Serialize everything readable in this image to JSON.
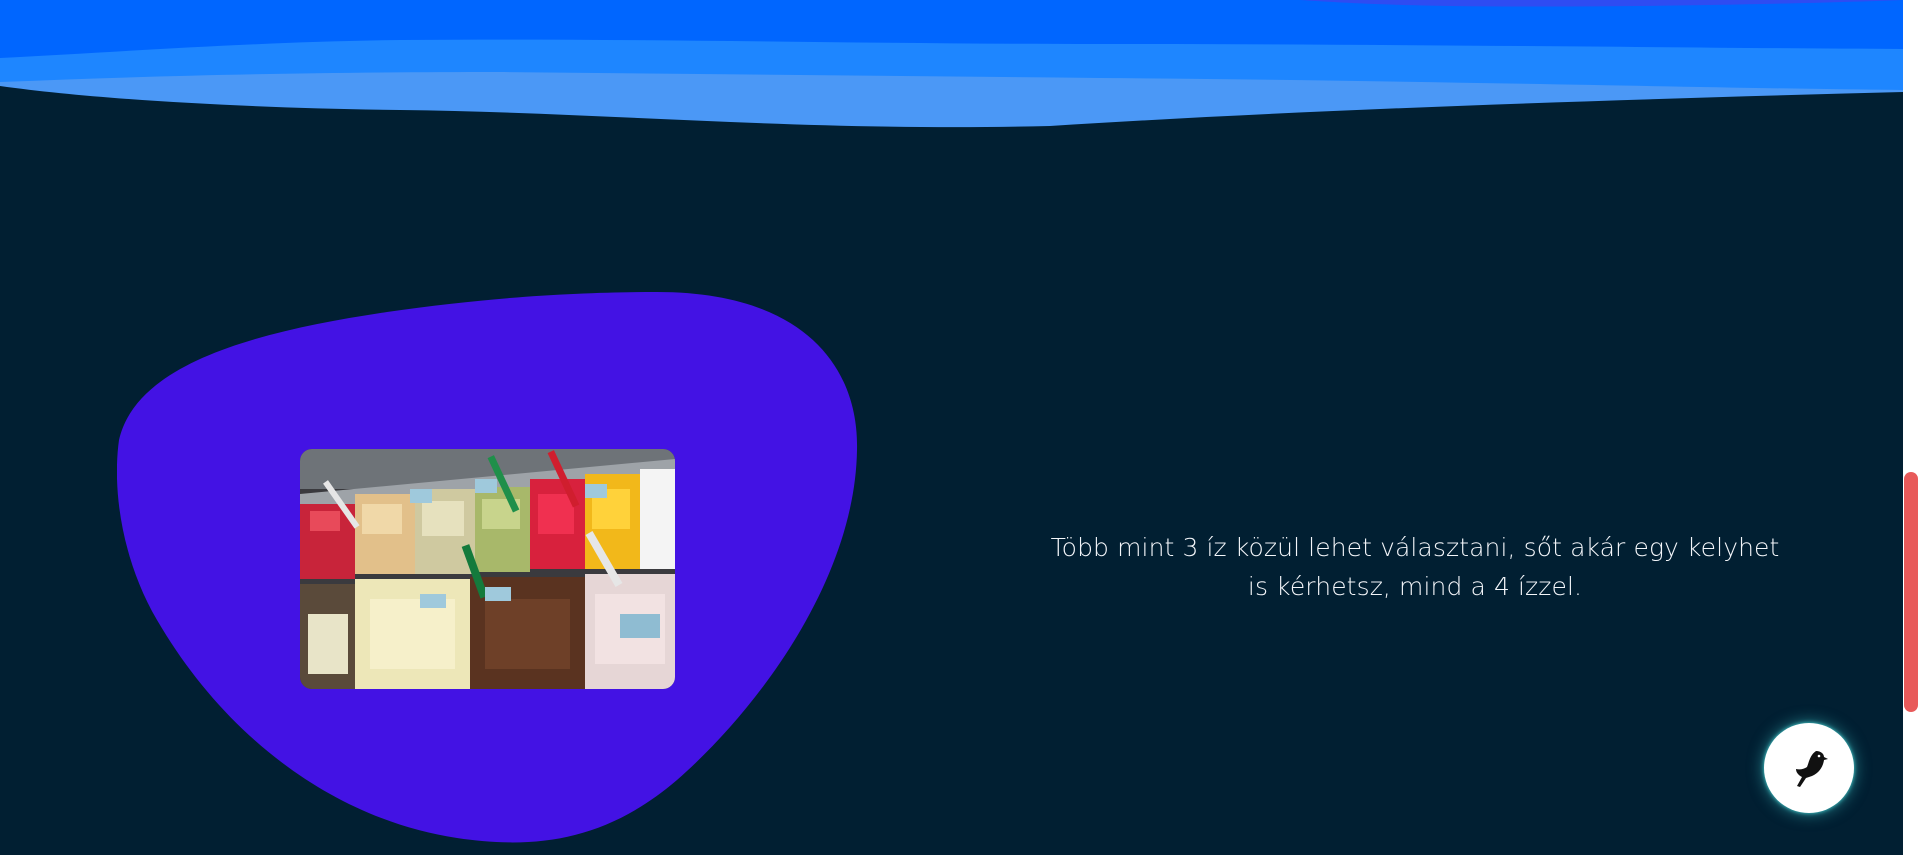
{
  "colors": {
    "background": "#011F32",
    "wave_dark": "#0066FF",
    "wave_mid": "#1E86FF",
    "wave_light": "#4B98F6",
    "blob": "#4312E4",
    "caption_text": "#F4F6FA",
    "scroll_thumb": "#E85A5A"
  },
  "content": {
    "caption": "Több mint 3 íz közül lehet választani, sőt akár egy kelyhet is kérhetsz, mind a 4 ízzel.",
    "image_subject": "gelato-display-case"
  },
  "floating_button": {
    "icon": "bird-icon"
  }
}
